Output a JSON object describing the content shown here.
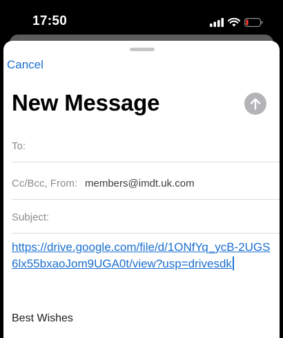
{
  "status_bar": {
    "time": "17:50",
    "icons": [
      "cellular-signal-icon",
      "wifi-icon",
      "battery-low-icon"
    ],
    "battery_color": "#ff3b30"
  },
  "compose": {
    "cancel_label": "Cancel",
    "title": "New Message",
    "send_icon": "arrow-up-icon",
    "fields": {
      "to_label": "To:",
      "to_value": "",
      "cc_label": "Cc/Bcc, From:",
      "from_value": "members@imdt.uk.com",
      "subject_label": "Subject:",
      "subject_value": ""
    },
    "body": {
      "link_text": "https://drive.google.com/file/d/1ONfYq_ycB-2UGS6lx55bxaoJom9UGA0t/view?usp=drivesdk",
      "signature": "Best Wishes"
    }
  },
  "colors": {
    "accent": "#1a6fd1",
    "send_button_disabled": "#b4b4b8"
  }
}
